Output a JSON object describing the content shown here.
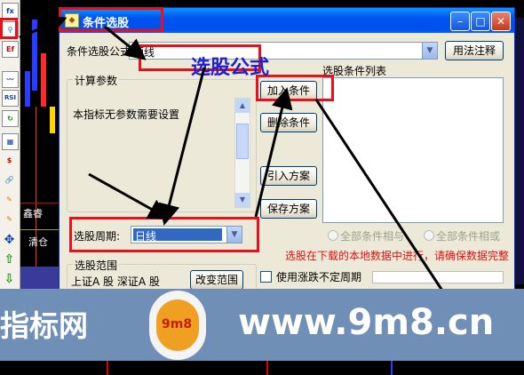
{
  "dialog": {
    "title": "条件选股",
    "formula_label": "条件选股公式",
    "formula_value": "短线",
    "help_button": "用法注释",
    "params_group": "计算参数",
    "params_text": "本指标无参数需要设置",
    "conditions_label": "选股条件列表",
    "add_condition": "加入条件",
    "delete_condition": "删除条件",
    "import_plan": "引入方案",
    "save_plan": "保存方案",
    "period_label": "选股周期:",
    "period_value": "日线",
    "all_and": "全部条件相与",
    "all_or": "全部条件相或",
    "warning": "选股在下载的本地数据中进行，请确保数据完整",
    "range_group": "选股范围",
    "range_value": "上证A 股  深证A 股",
    "change_range": "改变范围",
    "use_irregular": "使用涨跌不定周期"
  },
  "annotation": {
    "formula_callout": "选股公式"
  },
  "chart_labels": {
    "label1": "鑫睿",
    "label2": "清仓"
  },
  "watermark": {
    "left_text": "指标网",
    "right_text": "www.9m8.cn",
    "logo_text": "9m8"
  },
  "colors": {
    "annotation_red": "#e8101a",
    "callout_blue": "#2020d0",
    "title_blue": "#0053ee"
  },
  "toolbar": {
    "icons": [
      "fx-icon",
      "search-icon",
      "formula-icon",
      "wave-icon",
      "rsi-icon",
      "refresh-icon",
      "grid-icon",
      "dollar-icon",
      "link-icon",
      "pencil-icon",
      "pencil2-icon",
      "move-icon",
      "up-arrow-icon",
      "down-arrow-icon"
    ],
    "fx": "fx",
    "rsi": "RSI"
  }
}
